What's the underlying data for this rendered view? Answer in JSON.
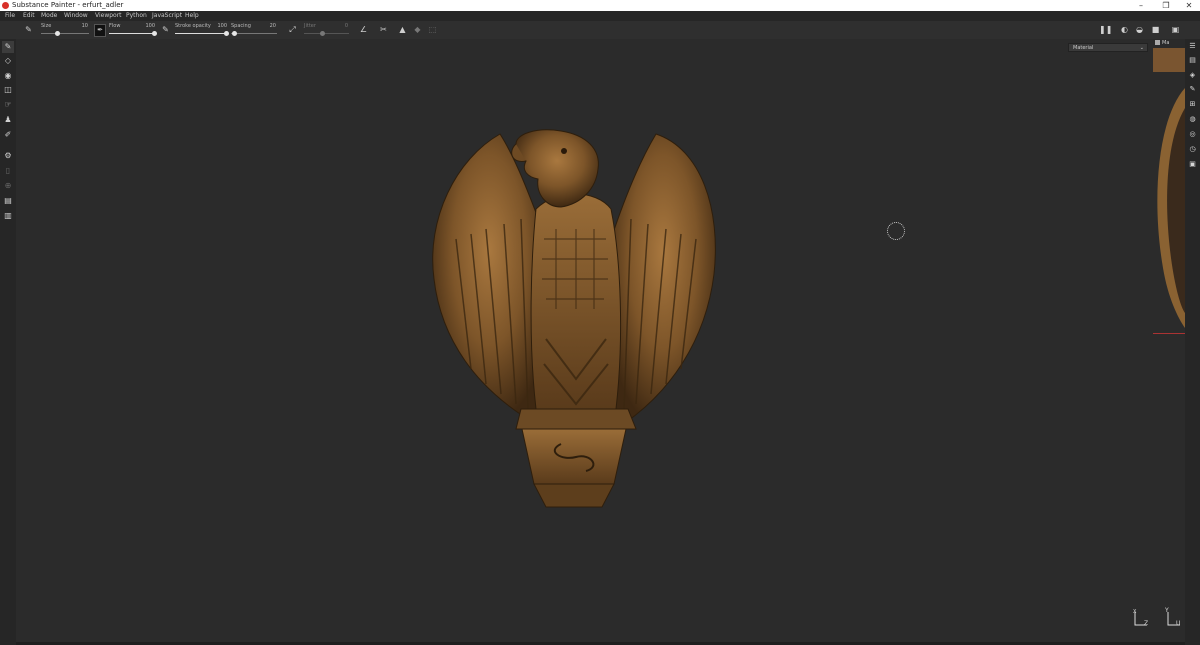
{
  "window": {
    "title": "Substance Painter - erfurt_adler",
    "controls": {
      "minimize": "–",
      "maximize": "❐",
      "close": "✕"
    }
  },
  "menu": [
    "File",
    "Edit",
    "Mode",
    "Window",
    "Viewport",
    "Python",
    "JavaScript",
    "Help"
  ],
  "toolbar": {
    "size_label": "Size",
    "size_value": "10",
    "flow_label": "Flow",
    "flow_value": "100",
    "opacity_label": "Stroke opacity",
    "opacity_value": "100",
    "spacing_label": "Spacing",
    "spacing_value": "20",
    "jitter_label": "Jitter",
    "jitter_value": "0"
  },
  "viewport": {
    "channel_dropdown": "Material",
    "axis_left": {
      "z": "Z",
      "x": "X"
    },
    "axis_right": {
      "y": "Y",
      "u": "U"
    }
  },
  "uv_panel": {
    "tab": "Ma"
  },
  "colors": {
    "titlebar": "#ffffff",
    "app_bg": "#2b2b2b",
    "bronze": "#8a6232",
    "accent": "#d8312a"
  }
}
